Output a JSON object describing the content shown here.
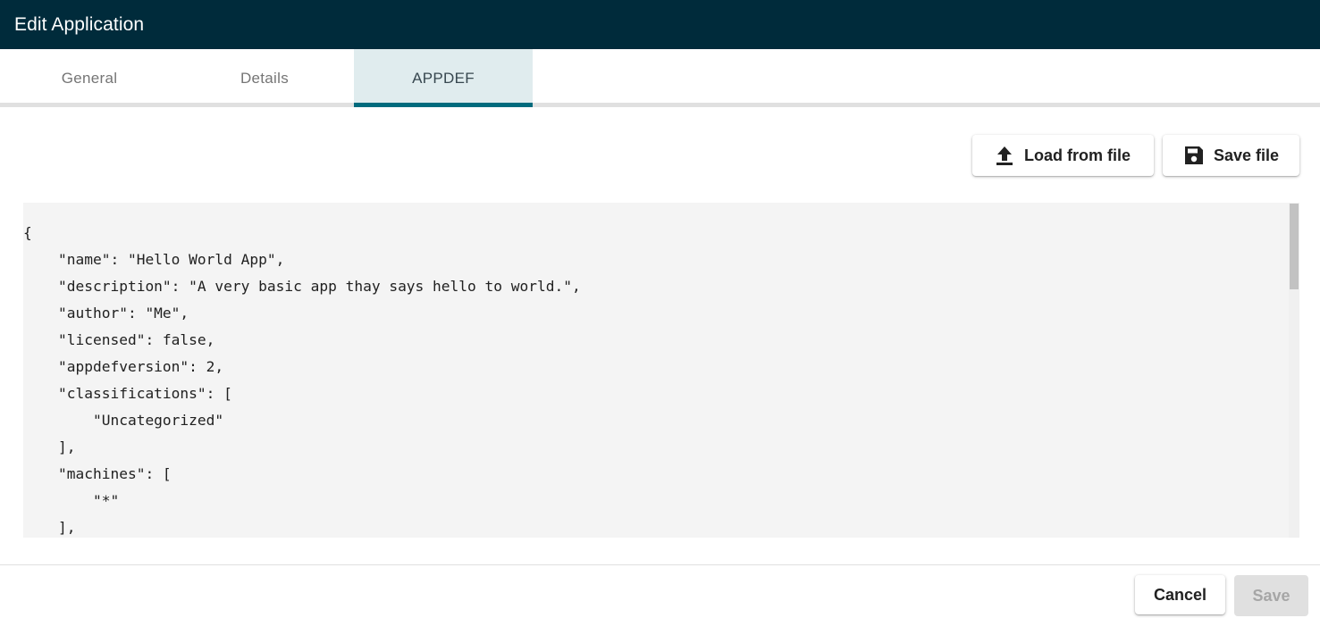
{
  "window": {
    "title": "Edit Application"
  },
  "tabs": [
    {
      "label": "General",
      "active": false
    },
    {
      "label": "Details",
      "active": false
    },
    {
      "label": "APPDEF",
      "active": true
    }
  ],
  "toolbar": {
    "load_label": "Load from file",
    "load_icon": "upload-icon",
    "save_label": "Save file",
    "save_icon": "floppy-disk-icon"
  },
  "editor": {
    "lines": [
      "{",
      "    \"name\": \"Hello World App\",",
      "    \"description\": \"A very basic app thay says hello to world.\",",
      "    \"author\": \"Me\",",
      "    \"licensed\": false,",
      "    \"appdefversion\": 2,",
      "    \"classifications\": [",
      "        \"Uncategorized\"",
      "    ],",
      "    \"machines\": [",
      "        \"*\"",
      "    ],"
    ]
  },
  "footer": {
    "cancel_label": "Cancel",
    "save_label": "Save",
    "save_disabled": true
  },
  "colors": {
    "header_bg": "#002b3b",
    "tab_active_bg": "#e0ecee",
    "tab_indicator": "#006b7d",
    "editor_bg": "#f4f4f4"
  }
}
